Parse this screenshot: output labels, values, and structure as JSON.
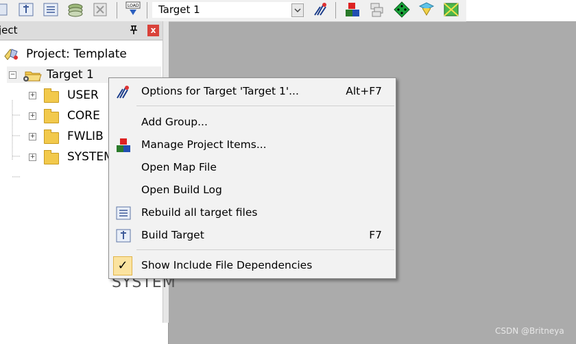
{
  "toolbar": {
    "target_select_value": "Target 1"
  },
  "project_panel": {
    "title": "ject",
    "pin_glyph": "ᆨ",
    "close_glyph": "x",
    "tree": {
      "project_label": "Project: Template",
      "target_label": "Target 1",
      "groups": [
        "USER",
        "CORE",
        "FWLIB",
        "SYSTEM"
      ]
    }
  },
  "context_menu": {
    "items": [
      {
        "label": "Options for Target 'Target 1'...",
        "shortcut": "Alt+F7"
      },
      {
        "label": "Add Group...",
        "shortcut": ""
      },
      {
        "label": "Manage Project Items...",
        "shortcut": ""
      },
      {
        "label": "Open Map File",
        "shortcut": ""
      },
      {
        "label": "Open Build Log",
        "shortcut": ""
      },
      {
        "label": "Rebuild all target files",
        "shortcut": ""
      },
      {
        "label": "Build Target",
        "shortcut": "F7"
      },
      {
        "label": "Show Include File Dependencies",
        "shortcut": "",
        "checked": true
      }
    ],
    "check_glyph": "✓"
  },
  "behind_text": "SYSTEM",
  "watermark": "CSDN @Britneya",
  "colors": {
    "workspace_bg": "#ababab",
    "menu_bg": "#f2f2f2",
    "check_highlight": "#fbe3a0",
    "folder": "#f2c94c",
    "close_button": "#d9423a"
  }
}
